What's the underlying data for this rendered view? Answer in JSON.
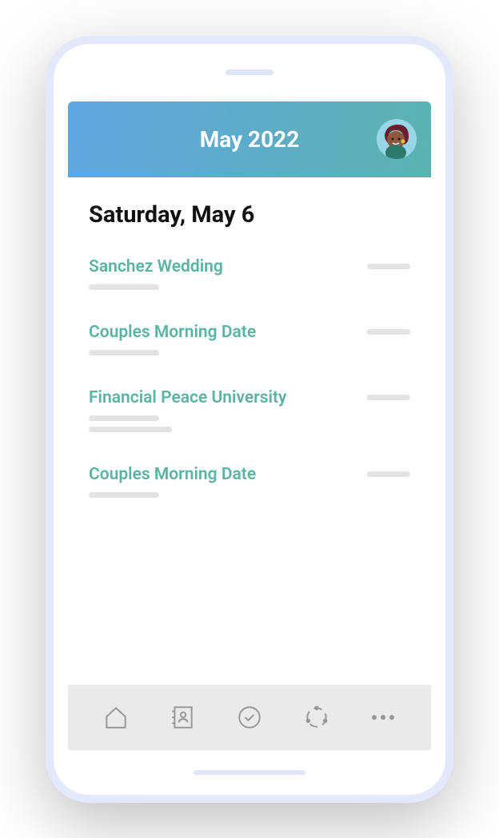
{
  "header": {
    "title": "May 2022"
  },
  "date_heading": "Saturday, May 6",
  "events": [
    {
      "title": "Sanchez Wedding",
      "detail_lines": 1
    },
    {
      "title": "Couples Morning Date",
      "detail_lines": 1
    },
    {
      "title": "Financial Peace University",
      "detail_lines": 2
    },
    {
      "title": "Couples Morning Date",
      "detail_lines": 1
    }
  ],
  "nav": {
    "items": [
      "home",
      "contacts",
      "tasks",
      "groups",
      "more"
    ]
  }
}
